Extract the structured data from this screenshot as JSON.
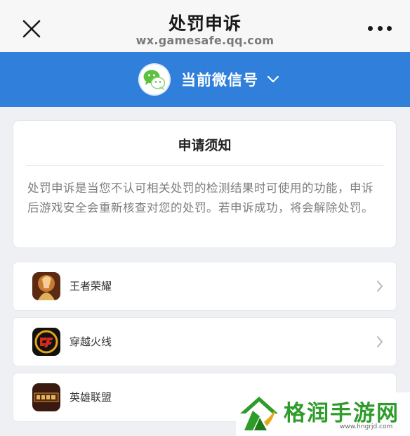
{
  "header": {
    "title": "处罚申诉",
    "url": "wx.gamesafe.qq.com"
  },
  "account": {
    "label": "当前微信号",
    "icon": "wechat-icon",
    "color": "#2f7fdb"
  },
  "notice": {
    "title": "申请须知",
    "body": "处罚申诉是当您不认可相关处罚的检测结果时可使用的功能，申诉后游戏安全会重新核查对您的处罚。若申诉成功，将会解除处罚。"
  },
  "games": [
    {
      "name": "王者荣耀",
      "icon": "honor-of-kings-icon"
    },
    {
      "name": "穿越火线",
      "icon": "crossfire-icon"
    },
    {
      "name": "英雄联盟",
      "icon": "league-of-legends-icon"
    }
  ],
  "watermark": {
    "text": "格润手游网",
    "url": "www.hngrjd.com",
    "color": "#2e9c2a"
  }
}
